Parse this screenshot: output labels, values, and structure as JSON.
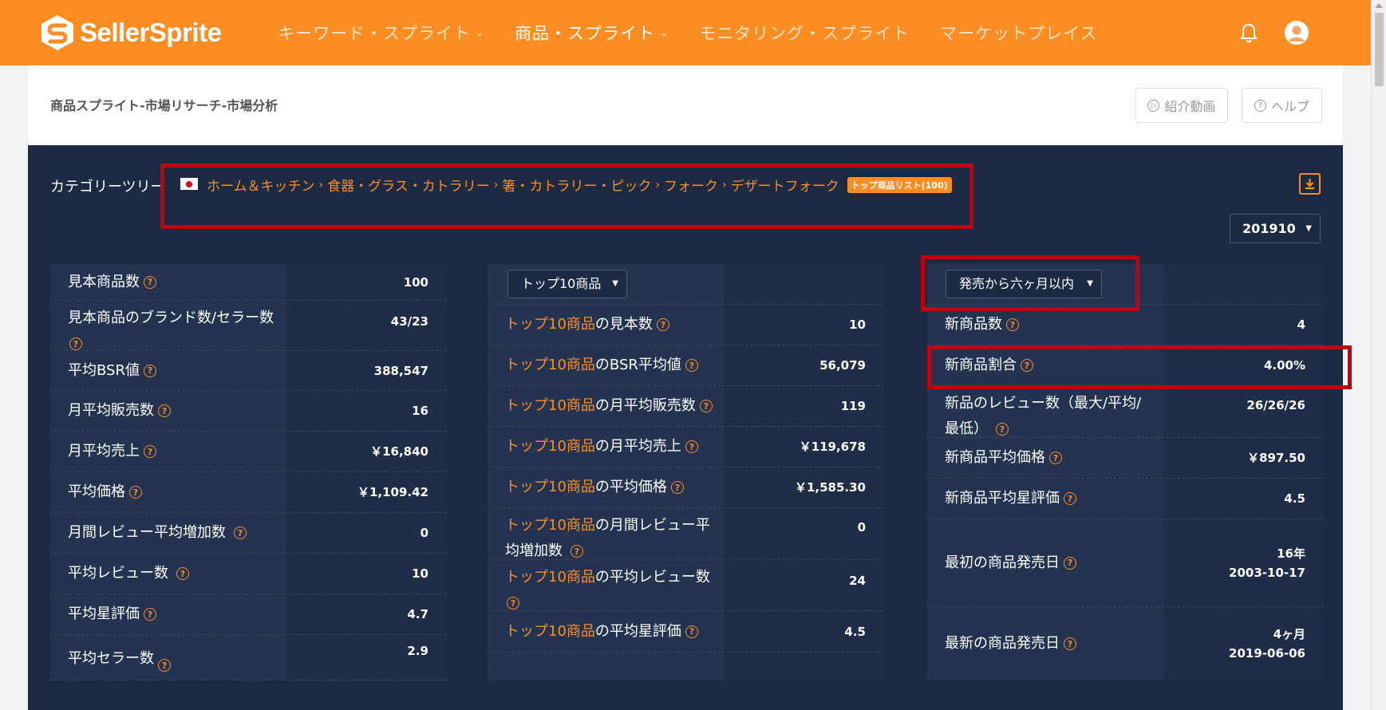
{
  "nav": {
    "logo_text": "SellerSprite",
    "items": [
      {
        "label": "キーワード・スプライト",
        "chevron": true,
        "active": false
      },
      {
        "label": "商品・スプライト",
        "chevron": true,
        "active": true
      },
      {
        "label": "モニタリング・スプライト",
        "chevron": false,
        "active": false
      },
      {
        "label": "マーケットプレイス",
        "chevron": false,
        "active": false
      }
    ]
  },
  "header": {
    "breadcrumb": "商品スプライト-市場リサーチ-市場分析",
    "intro_button": "紹介動画",
    "help_button": "ヘルプ"
  },
  "category": {
    "label": "カテゴリーツリー",
    "path": [
      "ホーム＆キッチン",
      "食器・グラス・カトラリー",
      "箸・カトラリー・ピック",
      "フォーク",
      "デザートフォーク"
    ],
    "badge": "トップ商品リスト(100)",
    "month": "201910"
  },
  "col1": [
    {
      "label": "見本商品数",
      "value": "100"
    },
    {
      "label": "見本商品のブランド数/セラー数",
      "value": "43/23"
    },
    {
      "label": "平均BSR値",
      "value": "388,547"
    },
    {
      "label": "月平均販売数",
      "value": "16"
    },
    {
      "label": "月平均売上",
      "value": "￥16,840"
    },
    {
      "label": "平均価格",
      "value": "￥1,109.42"
    },
    {
      "label": "月間レビュー平均増加数",
      "value": "0"
    },
    {
      "label": "平均レビュー数",
      "value": "10"
    },
    {
      "label": "平均星評価",
      "value": "4.7"
    },
    {
      "label": "平均セラー数",
      "value": "2.9"
    }
  ],
  "col2": {
    "select": "トップ10商品",
    "prefix": "トップ10商品",
    "rows": [
      {
        "label": "の見本数",
        "value": "10"
      },
      {
        "label": "のBSR平均値",
        "value": "56,079"
      },
      {
        "label": "の月平均販売数",
        "value": "119"
      },
      {
        "label": "の月平均売上",
        "value": "￥119,678"
      },
      {
        "label": "の平均価格",
        "value": "￥1,585.30"
      },
      {
        "label": "の月間レビュー平均増加数",
        "value": "0"
      },
      {
        "label": "の平均レビュー数",
        "value": "24"
      },
      {
        "label": "の平均星評価",
        "value": "4.5"
      }
    ]
  },
  "col3": {
    "select": "発売から六ヶ月以内",
    "rows": [
      {
        "label": "新商品数",
        "value": "4"
      },
      {
        "label": "新商品割合",
        "value": "4.00%"
      },
      {
        "label": "新品のレビュー数（最大/平均/最低）",
        "value": "26/26/26"
      },
      {
        "label": "新商品平均価格",
        "value": "￥897.50"
      },
      {
        "label": "新商品平均星評価",
        "value": "4.5"
      },
      {
        "label": "最初の商品発売日",
        "value": "16年",
        "value2": "2003-10-17"
      },
      {
        "label": "最新の商品発売日",
        "value": "4ヶ月",
        "value2": "2019-06-06"
      }
    ]
  },
  "colors": {
    "accent": "#fb8d23",
    "panel": "#1d2a44",
    "annotation": "#c0000a"
  }
}
